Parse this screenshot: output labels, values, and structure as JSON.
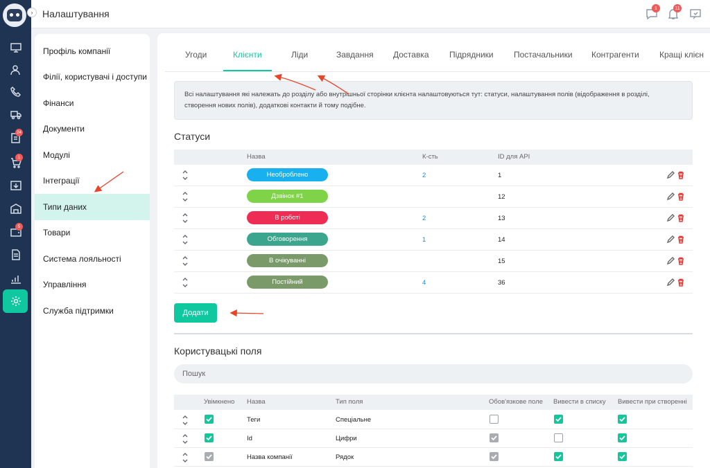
{
  "topbar": {
    "title": "Налаштування",
    "chat_badge": "1",
    "bell_badge": "11"
  },
  "rail": {
    "badges": {
      "task": "24",
      "cart": "1",
      "wallet": "5"
    }
  },
  "menu": {
    "items": [
      "Профіль компанії",
      "Філії, користувачі і доступи",
      "Фінанси",
      "Документи",
      "Модулі",
      "Інтеграції",
      "Типи даних",
      "Товари",
      "Система лояльності",
      "Управління",
      "Служба підтримки"
    ],
    "active_index": 6
  },
  "tabs": [
    "Угоди",
    "Клієнти",
    "Ліди",
    "Завдання",
    "Доставка",
    "Підрядники",
    "Постачальники",
    "Контрагенти",
    "Кращі клієн"
  ],
  "active_tab": "Клієнти",
  "info_text": "Всі налаштування які належать до розділу або внутрішньої сторінки клієнта налаштовуються тут: статуси, налаштування полів (відображення в розділі, створення нових полів), додаткові контакти й тому подібне.",
  "statuses": {
    "title": "Статуси",
    "headers": {
      "name": "Назва",
      "count": "К-сть",
      "api": "ID для API"
    },
    "rows": [
      {
        "name": "Необроблено",
        "color": "#18b0ee",
        "count": "2",
        "api_id": "1"
      },
      {
        "name": "Дзвінок #1",
        "color": "#7ed348",
        "count": "",
        "api_id": "12"
      },
      {
        "name": "В роботі",
        "color": "#ee2d55",
        "count": "2",
        "api_id": "13"
      },
      {
        "name": "Обговорення",
        "color": "#3ba58d",
        "count": "1",
        "api_id": "14"
      },
      {
        "name": "В очікуванні",
        "color": "#7a9a6a",
        "count": "",
        "api_id": "15"
      },
      {
        "name": "Постійний",
        "color": "#7a9a6a",
        "count": "4",
        "api_id": "36"
      }
    ],
    "add_label": "Додати"
  },
  "custom_fields": {
    "title": "Користувацькі поля",
    "search_placeholder": "Пошук",
    "headers": {
      "enabled": "Увімкнено",
      "name": "Назва",
      "type": "Тип поля",
      "required": "Обов'язкове поле",
      "in_list": "Вивести в списку",
      "on_create": "Вивести при створенні"
    },
    "rows": [
      {
        "enabled": "on",
        "name": "Теги",
        "type": "Спеціальне",
        "required": "off",
        "in_list": "on",
        "on_create": "on"
      },
      {
        "enabled": "on",
        "name": "Id",
        "type": "Цифри",
        "required": "grey",
        "in_list": "off",
        "on_create": "on"
      },
      {
        "enabled": "grey",
        "name": "Назва компанії",
        "type": "Рядок",
        "required": "grey",
        "in_list": "on",
        "on_create": "on"
      }
    ]
  },
  "colors": {
    "accent": "#0fc8a0",
    "rail": "#1e3452",
    "annotation": "#e8442a"
  }
}
